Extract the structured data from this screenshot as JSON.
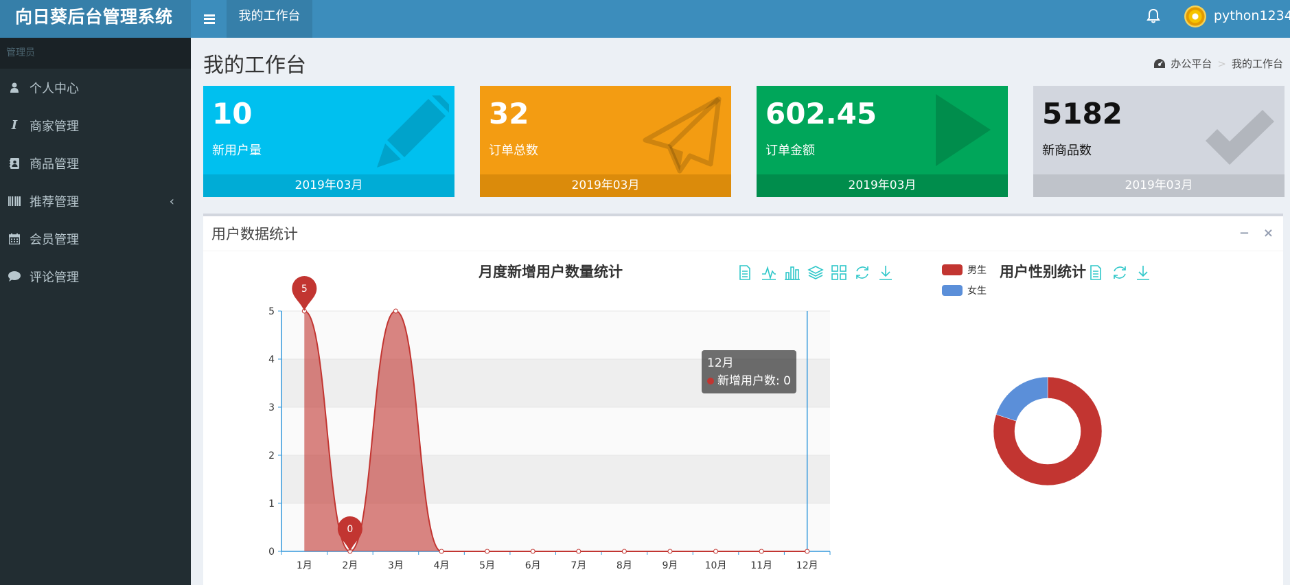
{
  "app": {
    "title": "向日葵后台管理系统",
    "active_tab": "我的工作台",
    "username": "python1234"
  },
  "sidebar": {
    "header": "管理员",
    "items": [
      {
        "label": "个人中心",
        "icon": "user-icon"
      },
      {
        "label": "商家管理",
        "icon": "italic-icon"
      },
      {
        "label": "商品管理",
        "icon": "address-book-icon"
      },
      {
        "label": "推荐管理",
        "icon": "barcode-icon",
        "expandable": true
      },
      {
        "label": "会员管理",
        "icon": "calendar-icon"
      },
      {
        "label": "评论管理",
        "icon": "comment-icon"
      }
    ]
  },
  "page": {
    "title": "我的工作台",
    "breadcrumb": [
      "办公平台",
      "我的工作台"
    ],
    "breadcrumb_sep": ">"
  },
  "stats": [
    {
      "value": "10",
      "label": "新用户量",
      "footer": "2019年03月",
      "color": "#00c0ef",
      "footer_color": "#00acd6",
      "icon": "pencil-icon"
    },
    {
      "value": "32",
      "label": "订单总数",
      "footer": "2019年03月",
      "color": "#f39c12",
      "footer_color": "#db8b0b",
      "icon": "paper-plane-icon"
    },
    {
      "value": "602.45",
      "label": "订单金额",
      "footer": "2019年03月",
      "color": "#00a65a",
      "footer_color": "#008d4c",
      "icon": "play-icon"
    },
    {
      "value": "5182",
      "label": "新商品数",
      "footer": "2019年03月",
      "color": "#d2d6de",
      "footer_color": "#bfc3ca",
      "icon": "check-icon"
    }
  ],
  "box": {
    "title": "用户数据统计",
    "tools": [
      "−",
      "×"
    ]
  },
  "chart_data": [
    {
      "type": "area",
      "title": "月度新增用户数量统计",
      "categories": [
        "1月",
        "2月",
        "3月",
        "4月",
        "5月",
        "6月",
        "7月",
        "8月",
        "9月",
        "10月",
        "11月",
        "12月"
      ],
      "series": [
        {
          "name": "新增用户数",
          "values": [
            5,
            0,
            5,
            0,
            0,
            0,
            0,
            0,
            0,
            0,
            0,
            0
          ],
          "color": "#c23531"
        }
      ],
      "ylim": [
        0,
        5
      ],
      "yticks": [
        "0",
        "1",
        "2",
        "3",
        "4",
        "5"
      ],
      "markers": [
        {
          "category": "1月",
          "label": "5",
          "type": "max"
        },
        {
          "category": "2月",
          "label": "0",
          "type": "min"
        }
      ],
      "tooltip": {
        "category": "12月",
        "series": "新增用户数",
        "value": "0",
        "title": "12月",
        "text": "新增用户数: 0"
      },
      "toolbox": [
        "data-view-icon",
        "line-icon",
        "bar-icon",
        "stack-icon",
        "tiled-icon",
        "restore-icon",
        "download-icon"
      ],
      "grid": true
    },
    {
      "type": "pie",
      "title": "用户性别统计",
      "legend": [
        {
          "name": "男生",
          "color": "#c23531"
        },
        {
          "name": "女生",
          "color": "#5b8fd9"
        }
      ],
      "slices": [
        {
          "name": "男生",
          "fraction": 0.8
        },
        {
          "name": "女生",
          "fraction": 0.2
        }
      ],
      "toolbox": [
        "data-view-icon",
        "restore-icon",
        "download-icon"
      ]
    }
  ]
}
